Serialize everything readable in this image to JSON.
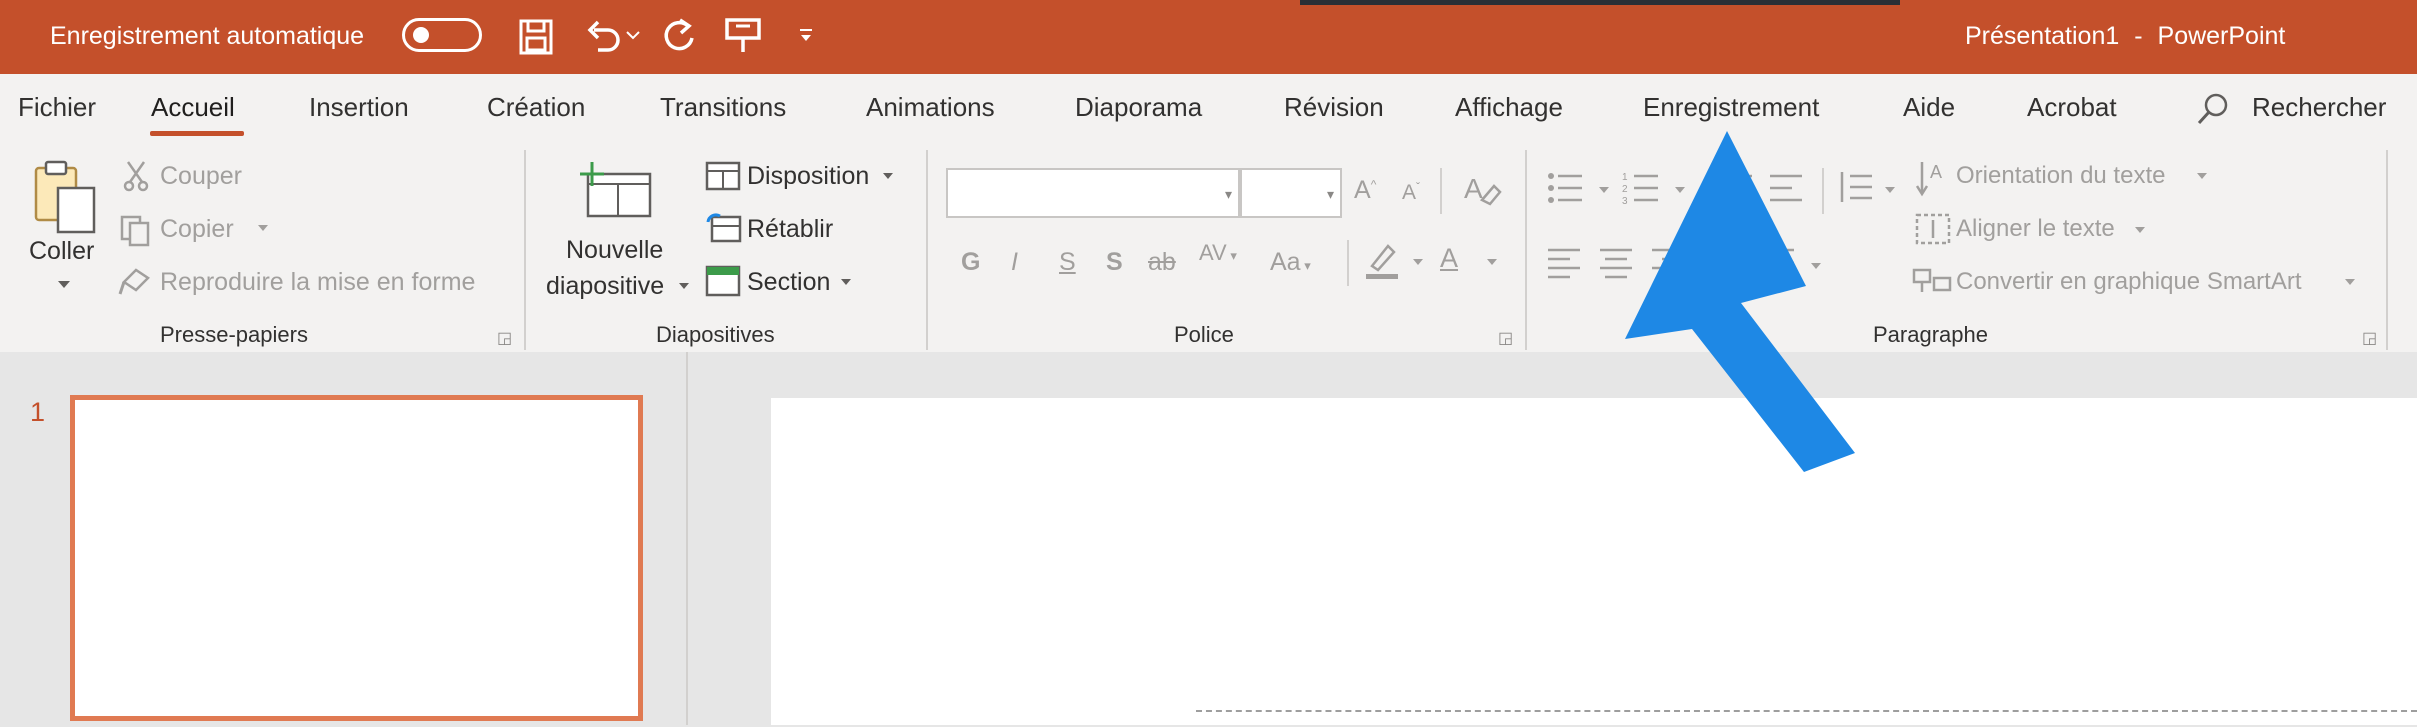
{
  "titlebar": {
    "autosave_label": "Enregistrement automatique",
    "doc_title": "Présentation1",
    "separator": "-",
    "app_name": "PowerPoint",
    "qat_icons": [
      "save-icon",
      "undo-icon",
      "redo-icon",
      "present-icon",
      "customize-icon"
    ]
  },
  "tabs": [
    "Fichier",
    "Accueil",
    "Insertion",
    "Création",
    "Transitions",
    "Animations",
    "Diaporama",
    "Révision",
    "Affichage",
    "Enregistrement",
    "Aide",
    "Acrobat"
  ],
  "active_tab": "Accueil",
  "search_label": "Rechercher",
  "clipboard": {
    "paste_label": "Coller",
    "cut_label": "Couper",
    "copy_label": "Copier",
    "format_painter_label": "Reproduire la mise en forme",
    "group_label": "Presse-papiers"
  },
  "slides": {
    "new_slide_line1": "Nouvelle",
    "new_slide_line2": "diapositive",
    "layout_label": "Disposition",
    "reset_label": "Rétablir",
    "section_label": "Section",
    "group_label": "Diapositives"
  },
  "font": {
    "font_name": "",
    "font_size": "",
    "grow_label": "A",
    "shrink_label": "A",
    "bold_label": "G",
    "italic_label": "I",
    "underline_label": "S",
    "shadow_label": "S",
    "strike_label": "ab",
    "spacing_label": "AV",
    "case_label": "Aa",
    "color_label": "A",
    "group_label": "Police"
  },
  "paragraph": {
    "text_direction_label": "Orientation du texte",
    "align_text_label": "Aligner le texte",
    "smartart_label": "Convertir en graphique SmartArt",
    "group_label": "Paragraphe"
  },
  "thumbnail": {
    "number": "1"
  },
  "colors": {
    "brand": "#c4502b",
    "arrow": "#1e88e5",
    "thumb_border": "#e07a52"
  }
}
